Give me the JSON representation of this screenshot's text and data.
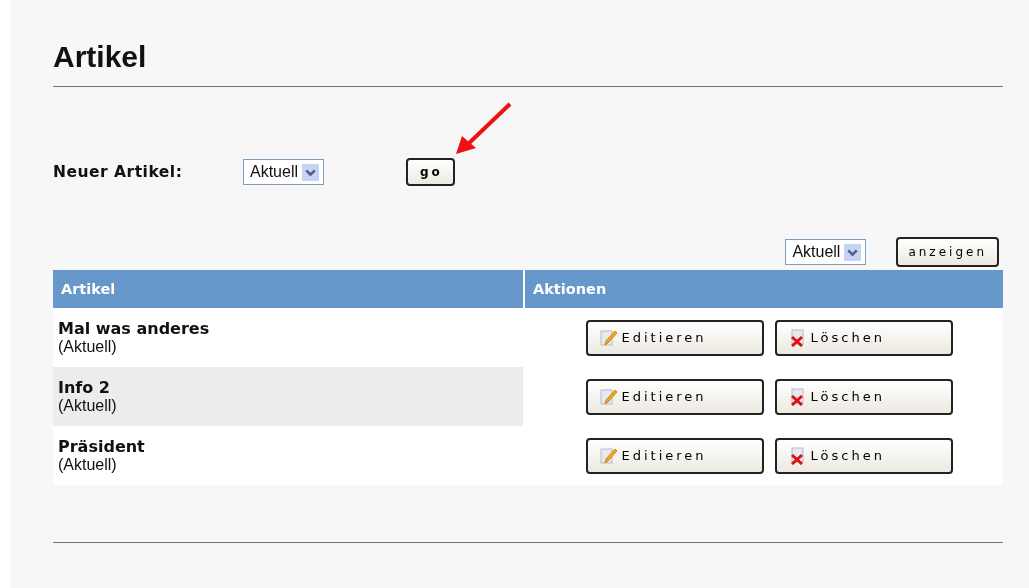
{
  "title": "Artikel",
  "new_article": {
    "label": "Neuer Artikel:",
    "select_value": "Aktuell",
    "button": "go"
  },
  "filter": {
    "select_value": "Aktuell",
    "button": "anzeigen"
  },
  "table": {
    "columns": [
      "Artikel",
      "Aktionen"
    ],
    "rows": [
      {
        "title": "Mal was anderes",
        "category": "(Aktuell)",
        "actions": [
          {
            "kind": "edit",
            "label": "Editieren"
          },
          {
            "kind": "delete",
            "label": "Löschen"
          }
        ]
      },
      {
        "title": "Info 2",
        "category": "(Aktuell)",
        "actions": [
          {
            "kind": "edit",
            "label": "Editieren"
          },
          {
            "kind": "delete",
            "label": "Löschen"
          }
        ]
      },
      {
        "title": "Präsident",
        "category": "(Aktuell)",
        "actions": [
          {
            "kind": "edit",
            "label": "Editieren"
          },
          {
            "kind": "delete",
            "label": "Löschen"
          }
        ]
      }
    ]
  }
}
